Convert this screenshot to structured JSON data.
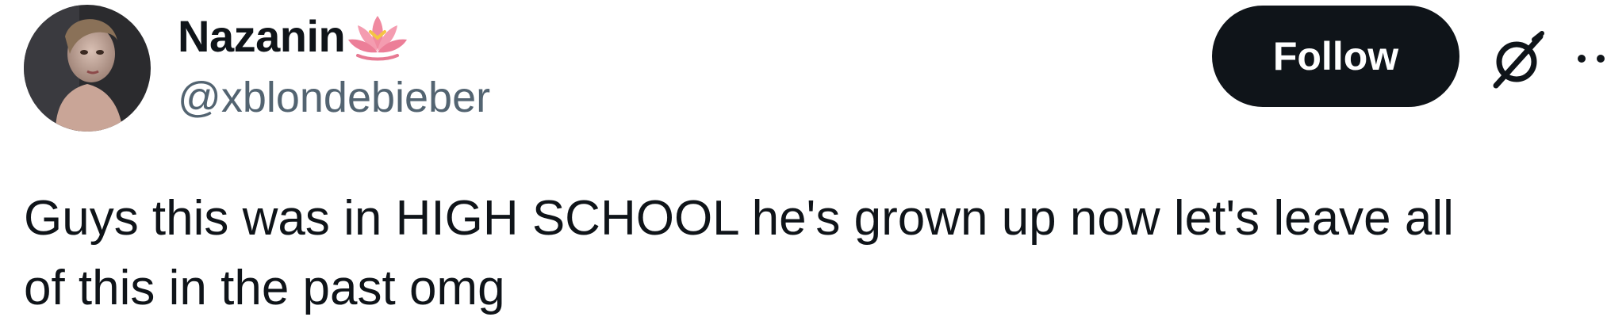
{
  "author": {
    "display_name": "Nazanin",
    "handle": "@xblondebieber",
    "name_emoji": "lotus-icon"
  },
  "actions": {
    "follow_label": "Follow",
    "grok_icon": "grok-icon",
    "more_icon": "more-icon"
  },
  "tweet": {
    "text_lines": [
      "Guys this was in HIGH SCHOOL he's grown up now let's leave all",
      "of this in the past omg"
    ]
  },
  "colors": {
    "text_primary": "#0f1419",
    "text_secondary": "#536471",
    "follow_bg": "#0f1419",
    "follow_fg": "#ffffff",
    "lotus_pink": "#f08aa0",
    "lotus_center": "#f5c542"
  }
}
